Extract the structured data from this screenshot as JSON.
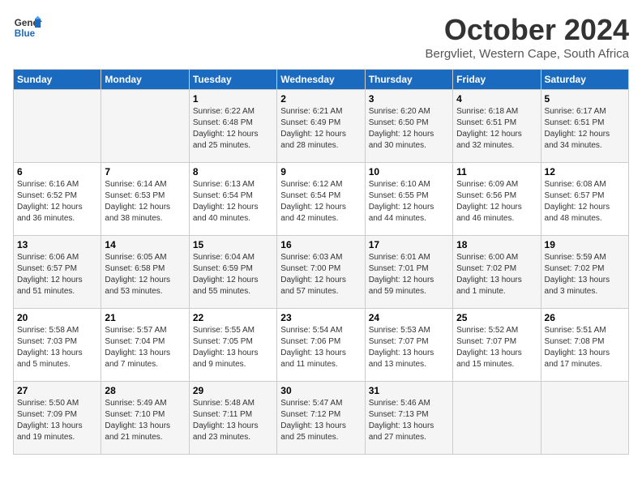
{
  "header": {
    "logo_general": "General",
    "logo_blue": "Blue",
    "month_title": "October 2024",
    "location": "Bergvliet, Western Cape, South Africa"
  },
  "weekdays": [
    "Sunday",
    "Monday",
    "Tuesday",
    "Wednesday",
    "Thursday",
    "Friday",
    "Saturday"
  ],
  "weeks": [
    [
      {
        "day": "",
        "content": ""
      },
      {
        "day": "",
        "content": ""
      },
      {
        "day": "1",
        "content": "Sunrise: 6:22 AM\nSunset: 6:48 PM\nDaylight: 12 hours\nand 25 minutes."
      },
      {
        "day": "2",
        "content": "Sunrise: 6:21 AM\nSunset: 6:49 PM\nDaylight: 12 hours\nand 28 minutes."
      },
      {
        "day": "3",
        "content": "Sunrise: 6:20 AM\nSunset: 6:50 PM\nDaylight: 12 hours\nand 30 minutes."
      },
      {
        "day": "4",
        "content": "Sunrise: 6:18 AM\nSunset: 6:51 PM\nDaylight: 12 hours\nand 32 minutes."
      },
      {
        "day": "5",
        "content": "Sunrise: 6:17 AM\nSunset: 6:51 PM\nDaylight: 12 hours\nand 34 minutes."
      }
    ],
    [
      {
        "day": "6",
        "content": "Sunrise: 6:16 AM\nSunset: 6:52 PM\nDaylight: 12 hours\nand 36 minutes."
      },
      {
        "day": "7",
        "content": "Sunrise: 6:14 AM\nSunset: 6:53 PM\nDaylight: 12 hours\nand 38 minutes."
      },
      {
        "day": "8",
        "content": "Sunrise: 6:13 AM\nSunset: 6:54 PM\nDaylight: 12 hours\nand 40 minutes."
      },
      {
        "day": "9",
        "content": "Sunrise: 6:12 AM\nSunset: 6:54 PM\nDaylight: 12 hours\nand 42 minutes."
      },
      {
        "day": "10",
        "content": "Sunrise: 6:10 AM\nSunset: 6:55 PM\nDaylight: 12 hours\nand 44 minutes."
      },
      {
        "day": "11",
        "content": "Sunrise: 6:09 AM\nSunset: 6:56 PM\nDaylight: 12 hours\nand 46 minutes."
      },
      {
        "day": "12",
        "content": "Sunrise: 6:08 AM\nSunset: 6:57 PM\nDaylight: 12 hours\nand 48 minutes."
      }
    ],
    [
      {
        "day": "13",
        "content": "Sunrise: 6:06 AM\nSunset: 6:57 PM\nDaylight: 12 hours\nand 51 minutes."
      },
      {
        "day": "14",
        "content": "Sunrise: 6:05 AM\nSunset: 6:58 PM\nDaylight: 12 hours\nand 53 minutes."
      },
      {
        "day": "15",
        "content": "Sunrise: 6:04 AM\nSunset: 6:59 PM\nDaylight: 12 hours\nand 55 minutes."
      },
      {
        "day": "16",
        "content": "Sunrise: 6:03 AM\nSunset: 7:00 PM\nDaylight: 12 hours\nand 57 minutes."
      },
      {
        "day": "17",
        "content": "Sunrise: 6:01 AM\nSunset: 7:01 PM\nDaylight: 12 hours\nand 59 minutes."
      },
      {
        "day": "18",
        "content": "Sunrise: 6:00 AM\nSunset: 7:02 PM\nDaylight: 13 hours\nand 1 minute."
      },
      {
        "day": "19",
        "content": "Sunrise: 5:59 AM\nSunset: 7:02 PM\nDaylight: 13 hours\nand 3 minutes."
      }
    ],
    [
      {
        "day": "20",
        "content": "Sunrise: 5:58 AM\nSunset: 7:03 PM\nDaylight: 13 hours\nand 5 minutes."
      },
      {
        "day": "21",
        "content": "Sunrise: 5:57 AM\nSunset: 7:04 PM\nDaylight: 13 hours\nand 7 minutes."
      },
      {
        "day": "22",
        "content": "Sunrise: 5:55 AM\nSunset: 7:05 PM\nDaylight: 13 hours\nand 9 minutes."
      },
      {
        "day": "23",
        "content": "Sunrise: 5:54 AM\nSunset: 7:06 PM\nDaylight: 13 hours\nand 11 minutes."
      },
      {
        "day": "24",
        "content": "Sunrise: 5:53 AM\nSunset: 7:07 PM\nDaylight: 13 hours\nand 13 minutes."
      },
      {
        "day": "25",
        "content": "Sunrise: 5:52 AM\nSunset: 7:07 PM\nDaylight: 13 hours\nand 15 minutes."
      },
      {
        "day": "26",
        "content": "Sunrise: 5:51 AM\nSunset: 7:08 PM\nDaylight: 13 hours\nand 17 minutes."
      }
    ],
    [
      {
        "day": "27",
        "content": "Sunrise: 5:50 AM\nSunset: 7:09 PM\nDaylight: 13 hours\nand 19 minutes."
      },
      {
        "day": "28",
        "content": "Sunrise: 5:49 AM\nSunset: 7:10 PM\nDaylight: 13 hours\nand 21 minutes."
      },
      {
        "day": "29",
        "content": "Sunrise: 5:48 AM\nSunset: 7:11 PM\nDaylight: 13 hours\nand 23 minutes."
      },
      {
        "day": "30",
        "content": "Sunrise: 5:47 AM\nSunset: 7:12 PM\nDaylight: 13 hours\nand 25 minutes."
      },
      {
        "day": "31",
        "content": "Sunrise: 5:46 AM\nSunset: 7:13 PM\nDaylight: 13 hours\nand 27 minutes."
      },
      {
        "day": "",
        "content": ""
      },
      {
        "day": "",
        "content": ""
      }
    ]
  ]
}
